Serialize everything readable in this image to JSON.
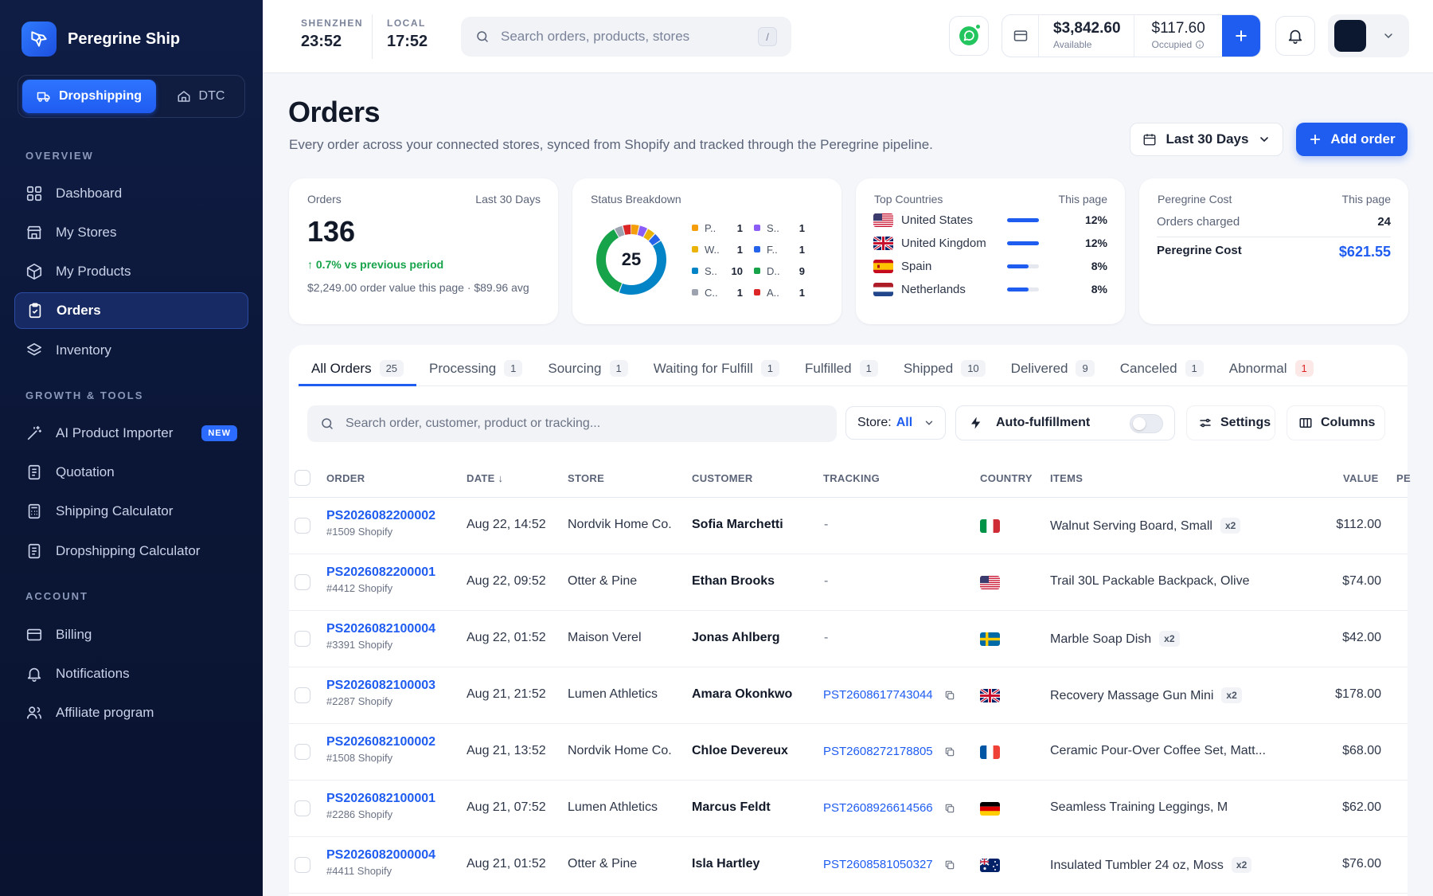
{
  "brand": {
    "name": "Peregrine Ship"
  },
  "mode": {
    "primary": "Dropshipping",
    "secondary": "DTC"
  },
  "sidebar": {
    "overview_label": "OVERVIEW",
    "overview": [
      {
        "label": "Dashboard",
        "icon": "grid-icon"
      },
      {
        "label": "My Stores",
        "icon": "store-icon"
      },
      {
        "label": "My Products",
        "icon": "box-icon"
      },
      {
        "label": "Orders",
        "icon": "clipboard-icon",
        "active": true
      },
      {
        "label": "Inventory",
        "icon": "layers-icon"
      }
    ],
    "growth_label": "GROWTH & TOOLS",
    "growth": [
      {
        "label": "AI Product Importer",
        "icon": "wand-icon",
        "badge": "NEW"
      },
      {
        "label": "Quotation",
        "icon": "document-icon"
      },
      {
        "label": "Shipping Calculator",
        "icon": "calculator-icon"
      },
      {
        "label": "Dropshipping Calculator",
        "icon": "document-icon"
      }
    ],
    "account_label": "ACCOUNT",
    "account": [
      {
        "label": "Billing",
        "icon": "card-icon"
      },
      {
        "label": "Notifications",
        "icon": "bell-icon"
      },
      {
        "label": "Affiliate program",
        "icon": "users-icon"
      }
    ]
  },
  "topbar": {
    "clock1": {
      "label": "SHENZHEN",
      "time": "23:52"
    },
    "clock2": {
      "label": "LOCAL",
      "time": "17:52"
    },
    "search_placeholder": "Search orders, products, stores",
    "search_shortcut": "/",
    "wallet": {
      "available_amount": "$3,842.60",
      "available_label": "Available",
      "occupied_amount": "$117.60",
      "occupied_label": "Occupied"
    }
  },
  "page": {
    "title": "Orders",
    "subtitle": "Every order across your connected stores, synced from Shopify and tracked through the Peregrine pipeline.",
    "range": "Last 30 Days",
    "add_label": "Add order"
  },
  "cards": {
    "orders": {
      "title": "Orders",
      "period": "Last 30 Days",
      "value": "136",
      "trend": "0.7% vs previous period",
      "note": "$2,249.00 order value this page · $89.96 avg"
    },
    "status": {
      "title": "Status Breakdown",
      "total": "25",
      "items": [
        {
          "label": "P..",
          "value": 1,
          "color": "#f59e0b"
        },
        {
          "label": "S..",
          "value": 1,
          "color": "#8b5cf6"
        },
        {
          "label": "W..",
          "value": 1,
          "color": "#eab308"
        },
        {
          "label": "F..",
          "value": 1,
          "color": "#2563eb"
        },
        {
          "label": "S..",
          "value": 10,
          "color": "#0284c7"
        },
        {
          "label": "D..",
          "value": 9,
          "color": "#16a34a"
        },
        {
          "label": "C..",
          "value": 1,
          "color": "#9ca3af"
        },
        {
          "label": "A..",
          "value": 1,
          "color": "#dc2626"
        }
      ]
    },
    "countries": {
      "title": "Top Countries",
      "scope": "This page",
      "items": [
        {
          "name": "United States",
          "pct": "12%",
          "share": 12,
          "flag": "us"
        },
        {
          "name": "United Kingdom",
          "pct": "12%",
          "share": 12,
          "flag": "gb"
        },
        {
          "name": "Spain",
          "pct": "8%",
          "share": 8,
          "flag": "es"
        },
        {
          "name": "Netherlands",
          "pct": "8%",
          "share": 8,
          "flag": "nl"
        }
      ]
    },
    "cost": {
      "title": "Peregrine Cost",
      "scope": "This page",
      "charged_label": "Orders charged",
      "charged_value": "24",
      "cost_label": "Peregrine Cost",
      "cost_value": "$621.55"
    }
  },
  "tabs": [
    {
      "label": "All Orders",
      "count": "25",
      "active": true
    },
    {
      "label": "Processing",
      "count": "1"
    },
    {
      "label": "Sourcing",
      "count": "1"
    },
    {
      "label": "Waiting for Fulfill",
      "count": "1"
    },
    {
      "label": "Fulfilled",
      "count": "1"
    },
    {
      "label": "Shipped",
      "count": "10"
    },
    {
      "label": "Delivered",
      "count": "9"
    },
    {
      "label": "Canceled",
      "count": "1"
    },
    {
      "label": "Abnormal",
      "count": "1",
      "alert": true
    }
  ],
  "filters": {
    "search_placeholder": "Search order, customer, product or tracking...",
    "store_label": "Store:",
    "store_value": "All",
    "auto_label": "Auto-fulfillment",
    "settings_label": "Settings",
    "columns_label": "Columns"
  },
  "table": {
    "headers": {
      "order": "ORDER",
      "date": "DATE",
      "store": "STORE",
      "customer": "CUSTOMER",
      "tracking": "TRACKING",
      "country": "COUNTRY",
      "items": "ITEMS",
      "value": "VALUE",
      "extra": "PE"
    },
    "rows": [
      {
        "id": "PS2026082200002",
        "ref": "#1509 Shopify",
        "date": "Aug 22, 14:52",
        "store": "Nordvik Home Co.",
        "customer": "Sofia Marchetti",
        "tracking": "-",
        "flag": "it",
        "item": "Walnut Serving Board, Small",
        "qty": "x2",
        "value": "$112.00"
      },
      {
        "id": "PS2026082200001",
        "ref": "#4412 Shopify",
        "date": "Aug 22, 09:52",
        "store": "Otter & Pine",
        "customer": "Ethan Brooks",
        "tracking": "-",
        "flag": "us",
        "item": "Trail 30L Packable Backpack, Olive",
        "qty": "",
        "value": "$74.00"
      },
      {
        "id": "PS2026082100004",
        "ref": "#3391 Shopify",
        "date": "Aug 22, 01:52",
        "store": "Maison Verel",
        "customer": "Jonas Ahlberg",
        "tracking": "-",
        "flag": "se",
        "item": "Marble Soap Dish",
        "qty": "x2",
        "value": "$42.00"
      },
      {
        "id": "PS2026082100003",
        "ref": "#2287 Shopify",
        "date": "Aug 21, 21:52",
        "store": "Lumen Athletics",
        "customer": "Amara Okonkwo",
        "tracking": "PST2608617743044",
        "flag": "gb",
        "item": "Recovery Massage Gun Mini",
        "qty": "x2",
        "value": "$178.00"
      },
      {
        "id": "PS2026082100002",
        "ref": "#1508 Shopify",
        "date": "Aug 21, 13:52",
        "store": "Nordvik Home Co.",
        "customer": "Chloe Devereux",
        "tracking": "PST2608272178805",
        "flag": "fr",
        "item": "Ceramic Pour-Over Coffee Set, Matt...",
        "qty": "",
        "value": "$68.00"
      },
      {
        "id": "PS2026082100001",
        "ref": "#2286 Shopify",
        "date": "Aug 21, 07:52",
        "store": "Lumen Athletics",
        "customer": "Marcus Feldt",
        "tracking": "PST2608926614566",
        "flag": "de",
        "item": "Seamless Training Leggings, M",
        "qty": "",
        "value": "$62.00"
      },
      {
        "id": "PS2026082000004",
        "ref": "#4411 Shopify",
        "date": "Aug 21, 01:52",
        "store": "Otter & Pine",
        "customer": "Isla Hartley",
        "tracking": "PST2608581050327",
        "flag": "au",
        "item": "Insulated Tumbler 24 oz, Moss",
        "qty": "x2",
        "value": "$76.00"
      }
    ]
  }
}
